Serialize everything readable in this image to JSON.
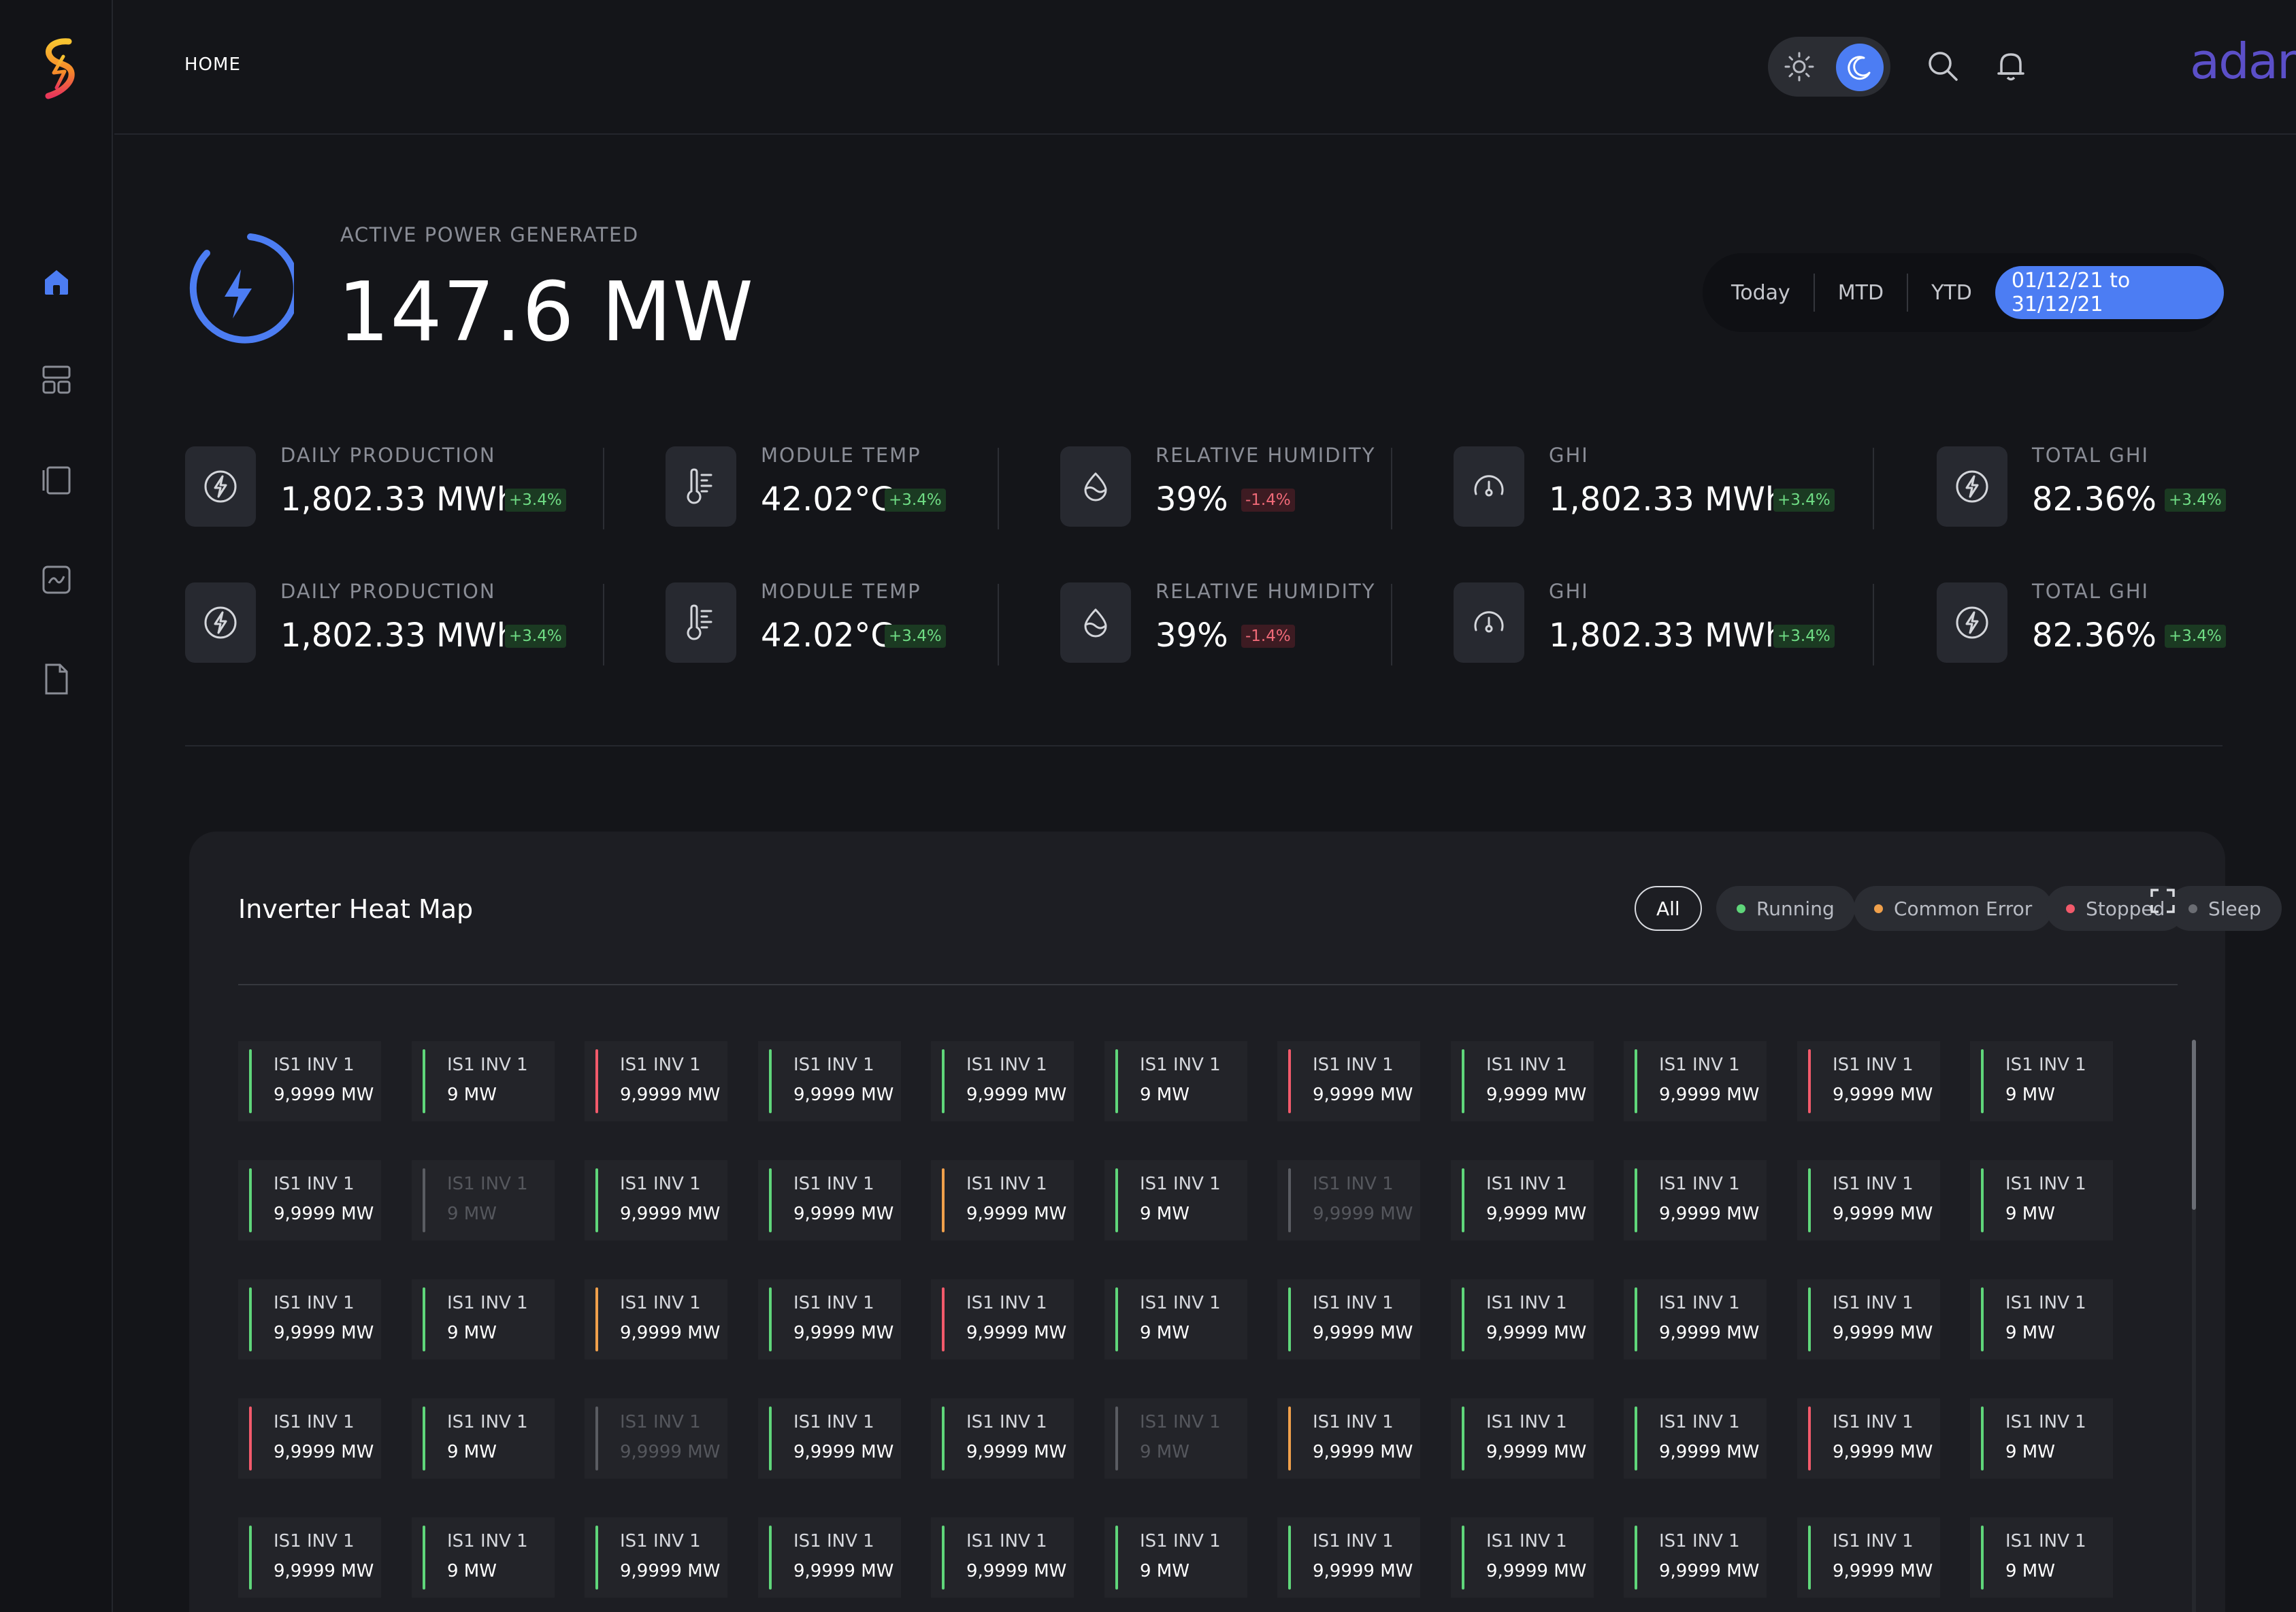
{
  "header": {
    "breadcrumb": "HOME",
    "brand": "adani",
    "icons": [
      "sun-icon",
      "moon-icon",
      "search-icon",
      "bell-icon",
      "chevron-down-icon"
    ]
  },
  "sidebar": {
    "items": [
      {
        "name": "home",
        "icon": "home-icon",
        "active": true
      },
      {
        "name": "dashboard",
        "icon": "grid-icon",
        "active": false
      },
      {
        "name": "panels",
        "icon": "frames-icon",
        "active": false
      },
      {
        "name": "analytics",
        "icon": "chart-icon",
        "active": false
      },
      {
        "name": "reports",
        "icon": "document-icon",
        "active": false
      }
    ]
  },
  "power": {
    "label": "ACTIVE POWER GENERATED",
    "value": "147.6 MW"
  },
  "period": {
    "tabs": [
      "Today",
      "MTD",
      "YTD"
    ],
    "range": "01/12/21 to 31/12/21"
  },
  "stats": [
    [
      {
        "label": "DAILY PRODUCTION",
        "value": "1,802.33 MWh",
        "delta": "+3.4%",
        "trend": "up",
        "icon": "bolt-icon"
      },
      {
        "label": "MODULE TEMP",
        "value": "42.02°C",
        "delta": "+3.4%",
        "trend": "up",
        "icon": "thermometer-icon"
      },
      {
        "label": "RELATIVE HUMIDITY",
        "value": "39%",
        "delta": "-1.4%",
        "trend": "down",
        "icon": "droplet-icon"
      },
      {
        "label": "GHI",
        "value": "1,802.33 MWh",
        "delta": "+3.4%",
        "trend": "up",
        "icon": "gauge-icon"
      },
      {
        "label": "TOTAL GHI",
        "value": "82.36%",
        "delta": "+3.4%",
        "trend": "up",
        "icon": "bolt-icon"
      }
    ],
    [
      {
        "label": "DAILY PRODUCTION",
        "value": "1,802.33 MWh",
        "delta": "+3.4%",
        "trend": "up",
        "icon": "bolt-icon"
      },
      {
        "label": "MODULE TEMP",
        "value": "42.02°C",
        "delta": "+3.4%",
        "trend": "up",
        "icon": "thermometer-icon"
      },
      {
        "label": "RELATIVE HUMIDITY",
        "value": "39%",
        "delta": "-1.4%",
        "trend": "down",
        "icon": "droplet-icon"
      },
      {
        "label": "GHI",
        "value": "1,802.33 MWh",
        "delta": "+3.4%",
        "trend": "up",
        "icon": "gauge-icon"
      },
      {
        "label": "TOTAL GHI",
        "value": "82.36%",
        "delta": "+3.4%",
        "trend": "up",
        "icon": "bolt-icon"
      }
    ]
  ],
  "heatmap": {
    "title": "Inverter Heat Map",
    "filters": [
      {
        "label": "All",
        "active": true
      },
      {
        "label": "Running",
        "color": "#5fd67a"
      },
      {
        "label": "Common Error",
        "color": "#f0a04b"
      },
      {
        "label": "Stopped",
        "color": "#f25a6b"
      },
      {
        "label": "Sleep",
        "color": "#6b6d73"
      }
    ],
    "status_colors": {
      "running": "#5fd67a",
      "error": "#f0a04b",
      "stopped": "#f25a6b",
      "sleep": "#5a5c62"
    },
    "rows": [
      [
        {
          "name": "IS1 INV 1",
          "value": "9,9999 MW",
          "status": "running"
        },
        {
          "name": "IS1 INV 1",
          "value": "9 MW",
          "status": "running"
        },
        {
          "name": "IS1 INV 1",
          "value": "9,9999 MW",
          "status": "stopped"
        },
        {
          "name": "IS1 INV 1",
          "value": "9,9999 MW",
          "status": "running"
        },
        {
          "name": "IS1 INV 1",
          "value": "9,9999 MW",
          "status": "running"
        },
        {
          "name": "IS1 INV 1",
          "value": "9 MW",
          "status": "running"
        },
        {
          "name": "IS1 INV 1",
          "value": "9,9999 MW",
          "status": "stopped"
        },
        {
          "name": "IS1 INV 1",
          "value": "9,9999 MW",
          "status": "running"
        },
        {
          "name": "IS1 INV 1",
          "value": "9,9999 MW",
          "status": "running"
        },
        {
          "name": "IS1 INV 1",
          "value": "9,9999 MW",
          "status": "stopped"
        },
        {
          "name": "IS1 INV 1",
          "value": "9 MW",
          "status": "running"
        }
      ],
      [
        {
          "name": "IS1 INV 1",
          "value": "9,9999 MW",
          "status": "running"
        },
        {
          "name": "IS1 INV 1",
          "value": "9 MW",
          "status": "sleep"
        },
        {
          "name": "IS1 INV 1",
          "value": "9,9999 MW",
          "status": "running"
        },
        {
          "name": "IS1 INV 1",
          "value": "9,9999 MW",
          "status": "running"
        },
        {
          "name": "IS1 INV 1",
          "value": "9,9999 MW",
          "status": "error"
        },
        {
          "name": "IS1 INV 1",
          "value": "9 MW",
          "status": "running"
        },
        {
          "name": "IS1 INV 1",
          "value": "9,9999 MW",
          "status": "sleep"
        },
        {
          "name": "IS1 INV 1",
          "value": "9,9999 MW",
          "status": "running"
        },
        {
          "name": "IS1 INV 1",
          "value": "9,9999 MW",
          "status": "running"
        },
        {
          "name": "IS1 INV 1",
          "value": "9,9999 MW",
          "status": "running"
        },
        {
          "name": "IS1 INV 1",
          "value": "9 MW",
          "status": "running"
        }
      ],
      [
        {
          "name": "IS1 INV 1",
          "value": "9,9999 MW",
          "status": "running"
        },
        {
          "name": "IS1 INV 1",
          "value": "9 MW",
          "status": "running"
        },
        {
          "name": "IS1 INV 1",
          "value": "9,9999 MW",
          "status": "error"
        },
        {
          "name": "IS1 INV 1",
          "value": "9,9999 MW",
          "status": "running"
        },
        {
          "name": "IS1 INV 1",
          "value": "9,9999 MW",
          "status": "stopped"
        },
        {
          "name": "IS1 INV 1",
          "value": "9 MW",
          "status": "running"
        },
        {
          "name": "IS1 INV 1",
          "value": "9,9999 MW",
          "status": "running"
        },
        {
          "name": "IS1 INV 1",
          "value": "9,9999 MW",
          "status": "running"
        },
        {
          "name": "IS1 INV 1",
          "value": "9,9999 MW",
          "status": "running"
        },
        {
          "name": "IS1 INV 1",
          "value": "9,9999 MW",
          "status": "running"
        },
        {
          "name": "IS1 INV 1",
          "value": "9 MW",
          "status": "running"
        }
      ],
      [
        {
          "name": "IS1 INV 1",
          "value": "9,9999 MW",
          "status": "stopped"
        },
        {
          "name": "IS1 INV 1",
          "value": "9 MW",
          "status": "running"
        },
        {
          "name": "IS1 INV 1",
          "value": "9,9999 MW",
          "status": "sleep"
        },
        {
          "name": "IS1 INV 1",
          "value": "9,9999 MW",
          "status": "running"
        },
        {
          "name": "IS1 INV 1",
          "value": "9,9999 MW",
          "status": "running"
        },
        {
          "name": "IS1 INV 1",
          "value": "9 MW",
          "status": "sleep"
        },
        {
          "name": "IS1 INV 1",
          "value": "9,9999 MW",
          "status": "error"
        },
        {
          "name": "IS1 INV 1",
          "value": "9,9999 MW",
          "status": "running"
        },
        {
          "name": "IS1 INV 1",
          "value": "9,9999 MW",
          "status": "running"
        },
        {
          "name": "IS1 INV 1",
          "value": "9,9999 MW",
          "status": "stopped"
        },
        {
          "name": "IS1 INV 1",
          "value": "9 MW",
          "status": "running"
        }
      ],
      [
        {
          "name": "IS1 INV 1",
          "value": "9,9999 MW",
          "status": "running"
        },
        {
          "name": "IS1 INV 1",
          "value": "9 MW",
          "status": "running"
        },
        {
          "name": "IS1 INV 1",
          "value": "9,9999 MW",
          "status": "running"
        },
        {
          "name": "IS1 INV 1",
          "value": "9,9999 MW",
          "status": "running"
        },
        {
          "name": "IS1 INV 1",
          "value": "9,9999 MW",
          "status": "running"
        },
        {
          "name": "IS1 INV 1",
          "value": "9 MW",
          "status": "running"
        },
        {
          "name": "IS1 INV 1",
          "value": "9,9999 MW",
          "status": "running"
        },
        {
          "name": "IS1 INV 1",
          "value": "9,9999 MW",
          "status": "running"
        },
        {
          "name": "IS1 INV 1",
          "value": "9,9999 MW",
          "status": "running"
        },
        {
          "name": "IS1 INV 1",
          "value": "9,9999 MW",
          "status": "running"
        },
        {
          "name": "IS1 INV 1",
          "value": "9 MW",
          "status": "running"
        }
      ]
    ]
  }
}
